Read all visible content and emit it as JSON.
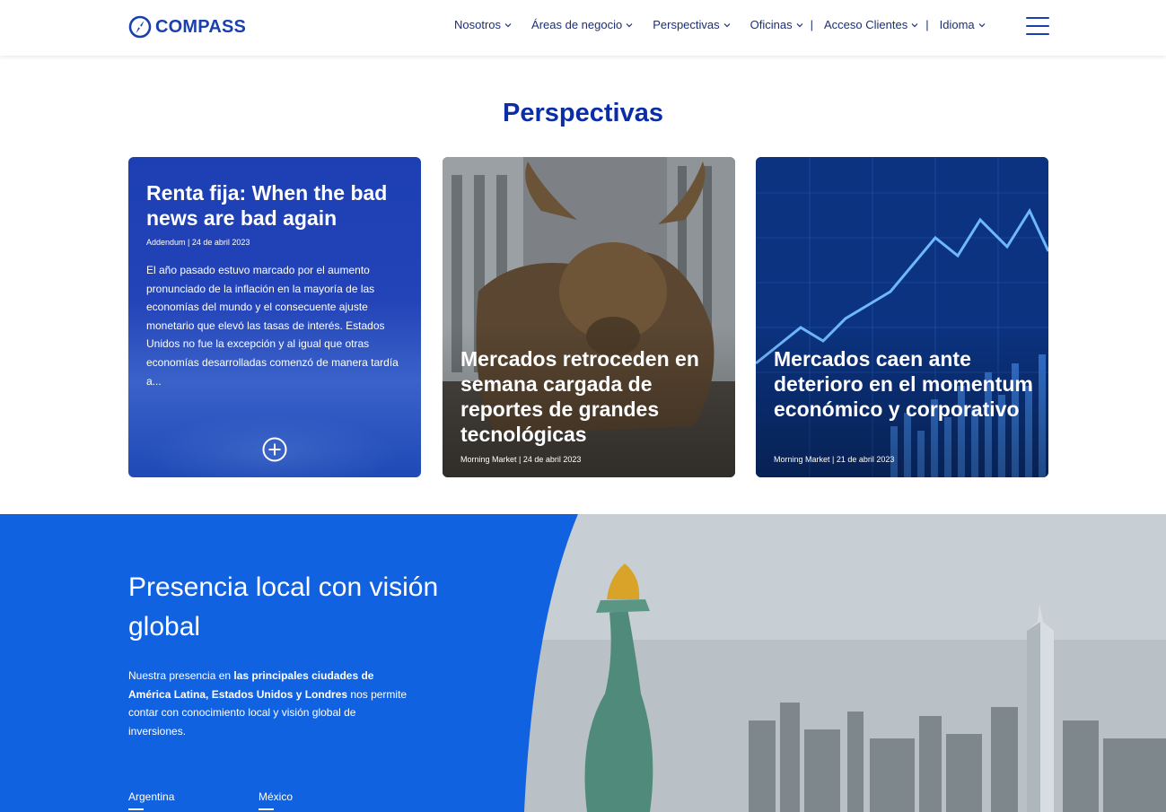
{
  "header": {
    "logo_text": "COMPASS",
    "nav": [
      {
        "label": "Nosotros"
      },
      {
        "label": "Áreas de negocio"
      },
      {
        "label": "Perspectivas"
      },
      {
        "label": "Oficinas"
      },
      {
        "label": "Acceso Clientes"
      },
      {
        "label": "Idioma"
      }
    ],
    "separator": "|",
    "colors": {
      "brand": "#1a3fae",
      "nav_text": "#1a2f7a"
    },
    "icons": {
      "logo": "compass-logo-icon",
      "menu": "hamburger-menu-icon",
      "dropdown": "chevron-down-icon"
    }
  },
  "perspectivas": {
    "title": "Perspectivas",
    "cards": [
      {
        "title": "Renta fija: When the bad news are bad again",
        "meta": "Addendum | 24 de abril 2023",
        "body": "El año pasado estuvo marcado por el aumento pronunciado de la inflación en la mayoría de las economías del mundo y el consecuente ajuste monetario que elevó las tasas de interés. Estados Unidos no fue la excepción y al igual que otras economías desarrolladas comenzó de manera tardía a...",
        "icon": "plus-circle-icon"
      },
      {
        "title": "Mercados retroceden en semana cargada de reportes de grandes tecnológicas",
        "meta": "Morning Market | 24 de abril 2023",
        "image": "bull-statue-image"
      },
      {
        "title": "Mercados caen ante deterioro en el momentum económico y corporativo",
        "meta": "Morning Market | 21 de abril 2023",
        "image": "stock-chart-image"
      }
    ]
  },
  "presence": {
    "title": "Presencia local con visión global",
    "text_before": "Nuestra presencia en ",
    "text_bold": "las principales ciudades de América Latina, Estados Unidos y Londres",
    "text_after": " nos permite contar con conocimiento local y visión global de inversiones.",
    "countries": [
      "Argentina",
      "México"
    ],
    "image": "new-york-skyline-image",
    "colors": {
      "background": "#1162e0"
    }
  }
}
